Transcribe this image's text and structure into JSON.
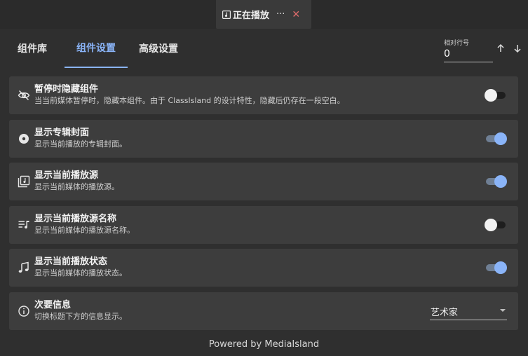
{
  "window_tab": {
    "title": "正在播放",
    "more_label": "···",
    "close_label": "✕"
  },
  "tabs": [
    {
      "label": "组件库",
      "active": false
    },
    {
      "label": "组件设置",
      "active": true
    },
    {
      "label": "高级设置",
      "active": false
    }
  ],
  "relative_row": {
    "label": "相对行号",
    "value": "0"
  },
  "settings": [
    {
      "title": "暂停时隐藏组件",
      "subtitle": "当当前媒体暂停时，隐藏本组件。由于 ClassIsland 的设计特性，隐藏后仍存在一段空白。",
      "icon": "eye-off-icon",
      "toggle": false
    },
    {
      "title": "显示专辑封面",
      "subtitle": "显示当前播放的专辑封面。",
      "icon": "album-icon",
      "toggle": true
    },
    {
      "title": "显示当前播放源",
      "subtitle": "显示当前媒体的播放源。",
      "icon": "library-music-icon",
      "toggle": true
    },
    {
      "title": "显示当前播放源名称",
      "subtitle": "显示当前媒体的播放源名称。",
      "icon": "queue-music-icon",
      "toggle": false
    },
    {
      "title": "显示当前播放状态",
      "subtitle": "显示当前媒体的播放状态。",
      "icon": "music-note-icon",
      "toggle": true
    }
  ],
  "secondary_info": {
    "title": "次要信息",
    "subtitle": "切换标题下方的信息显示。",
    "icon": "info-icon",
    "selected": "艺术家"
  },
  "footer": "Powered by MediaIsland",
  "colors": {
    "accent": "#8ab4f8",
    "close": "#e06c6c",
    "card": "#3d3d3d",
    "background": "#2f2f2f"
  }
}
